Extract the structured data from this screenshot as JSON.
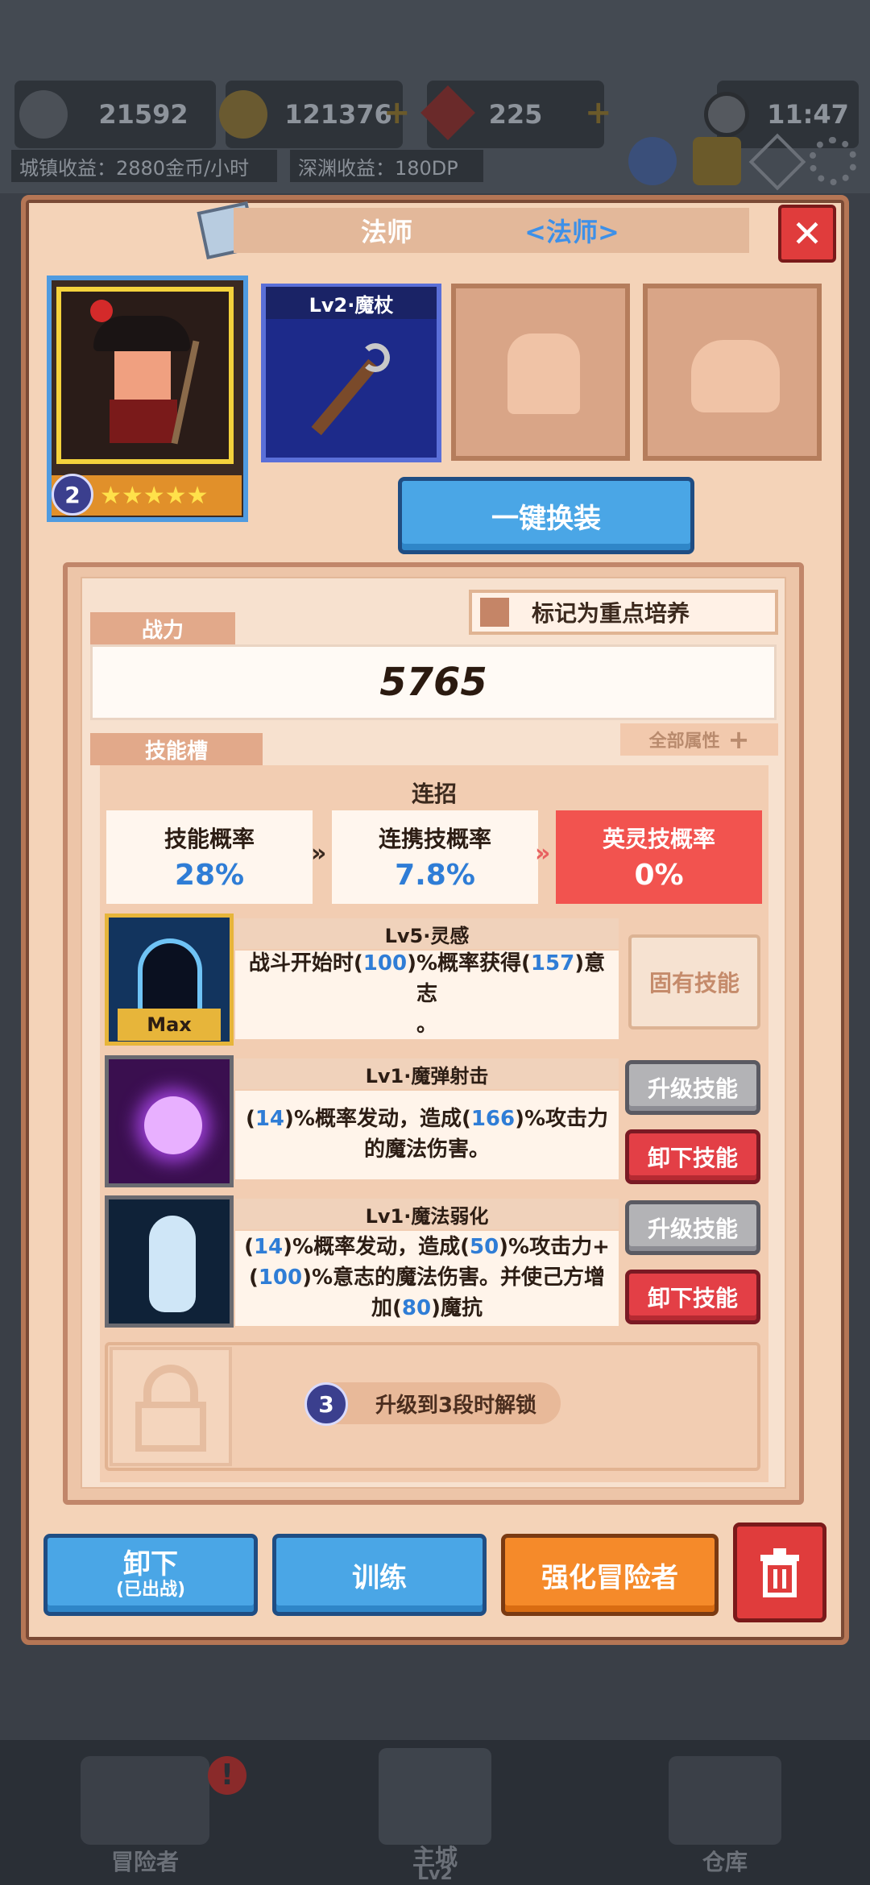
{
  "status_bar": {
    "power_value": "21592",
    "gold_value": "121376",
    "gem_value": "225",
    "time": "11:47",
    "town_income": "城镇收益：2880金币/小时",
    "abyss_income": "深渊收益：180DP"
  },
  "bottom_nav": {
    "adventurer_label": "冒险者",
    "main_city_label": "主城",
    "main_city_level": "Lv2",
    "warehouse_label": "仓库"
  },
  "modal": {
    "title": "法师",
    "class_tag": "<法师>",
    "close_symbol": "✕",
    "hero_level": "2",
    "hero_stars": "★★★★★",
    "weapon_label": "Lv2·魔杖",
    "equip_all_label": "一键换装",
    "power_tab": "战力",
    "mark_focus_label": "标记为重点培养",
    "power_value": "5765",
    "all_attributes_label": "全部属性",
    "skill_slots_tab": "技能槽",
    "combo_title": "连招",
    "rates": [
      {
        "label": "技能概率",
        "value": "28%"
      },
      {
        "label": "连携技概率",
        "value": "7.8%"
      },
      {
        "label": "英灵技概率",
        "value": "0%"
      }
    ],
    "skills": [
      {
        "name": "Lv5·灵感",
        "desc_a": "战斗开始时(",
        "n1": "100",
        "desc_b": ")%概率获得(",
        "n2": "157",
        "desc_c": ")意志",
        "desc_d": "。",
        "badge": "Max",
        "innate_label": "固有技能"
      },
      {
        "name": "Lv1·魔弹射击",
        "desc_a": "(",
        "n1": "14",
        "desc_b": ")%概率发动，造成(",
        "n2": "166",
        "desc_c": ")%攻击力",
        "desc_d": "的魔法伤害。",
        "upgrade_label": "升级技能",
        "remove_label": "卸下技能"
      },
      {
        "name": "Lv1·魔法弱化",
        "desc_a": "(",
        "n1": "14",
        "desc_b": ")%概率发动，造成(",
        "n2": "50",
        "desc_c": ")%攻击力+(",
        "n3": "100",
        "desc_d": ")%意志的魔法伤害。并使己方增加(",
        "n4": "80",
        "desc_e": ")魔抗",
        "upgrade_label": "升级技能",
        "remove_label": "卸下技能"
      }
    ],
    "locked_badge": "3",
    "locked_text": "升级到3段时解锁",
    "unequip_label": "卸下",
    "unequip_sub": "(已出战)",
    "train_label": "训练",
    "enhance_label": "强化冒险者"
  },
  "colors": {
    "modal_bg": "#f4d3b8",
    "accent_blue": "#4aa6e6",
    "accent_red": "#e03c3c",
    "accent_orange": "#f58a2a",
    "number_blue": "#2f7dd6"
  }
}
